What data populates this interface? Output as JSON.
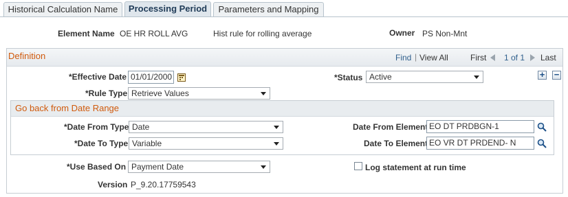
{
  "tabs": [
    {
      "label": "Historical Calculation Name",
      "active": false
    },
    {
      "label": "Processing Period",
      "active": true
    },
    {
      "label": "Parameters and Mapping",
      "active": false
    }
  ],
  "header": {
    "element_name_label": "Element Name",
    "element_name_value": "OE HR ROLL AVG",
    "description": "Hist rule for rolling average",
    "owner_label": "Owner",
    "owner_value": "PS Non-Mnt"
  },
  "definition": {
    "title": "Definition",
    "nav": {
      "find": "Find",
      "separator": "|",
      "view_all": "View All",
      "first": "First",
      "pager": "1 of 1",
      "last": "Last"
    },
    "effective_date_label": "*Effective Date",
    "effective_date_value": "01/01/2000",
    "status_label": "*Status",
    "status_value": "Active",
    "rule_type_label": "*Rule Type",
    "rule_type_value": "Retrieve Values",
    "add_row": "+",
    "delete_row": "−"
  },
  "go_back": {
    "title": "Go back from Date Range",
    "date_from_type_label": "*Date From Type",
    "date_from_type_value": "Date",
    "date_to_type_label": "*Date To Type",
    "date_to_type_value": "Variable",
    "date_from_element_label": "Date From Element",
    "date_from_element_value": "EO DT PRDBGN-1",
    "date_to_element_label": "Date To Element",
    "date_to_element_value": "EO VR DT PRDEND- N"
  },
  "footer": {
    "use_based_on_label": "*Use Based On",
    "use_based_on_value": "Payment Date",
    "log_statement_label": "Log statement at run time",
    "log_statement_checked": false,
    "version_label": "Version",
    "version_value": "P_9.20.17759543"
  },
  "colors": {
    "accent": "#d05a0c",
    "link": "#2f5f8c",
    "button": "#1b4f87"
  }
}
